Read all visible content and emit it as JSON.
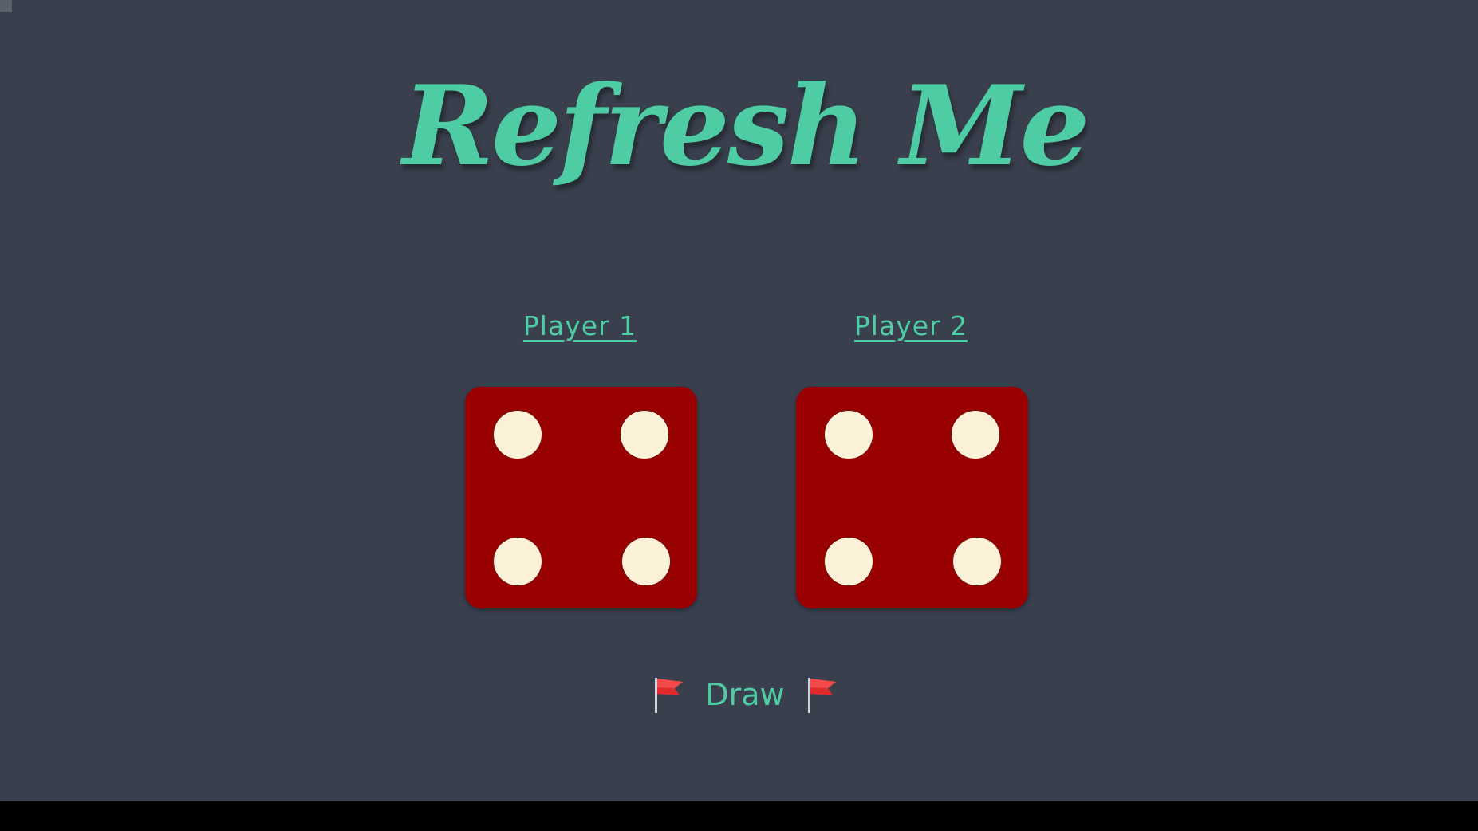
{
  "title": "Refresh Me",
  "players": [
    {
      "label": "Player 1",
      "die_value": 4
    },
    {
      "label": "Player 2",
      "die_value": 4
    }
  ],
  "result": {
    "text": "Draw",
    "icon": "red-flag-icon"
  },
  "colors": {
    "background": "#393f4d",
    "accent": "#4ecca3",
    "die": "#990000",
    "pip": "#fbf0d8",
    "bottom_bar": "#000000"
  }
}
